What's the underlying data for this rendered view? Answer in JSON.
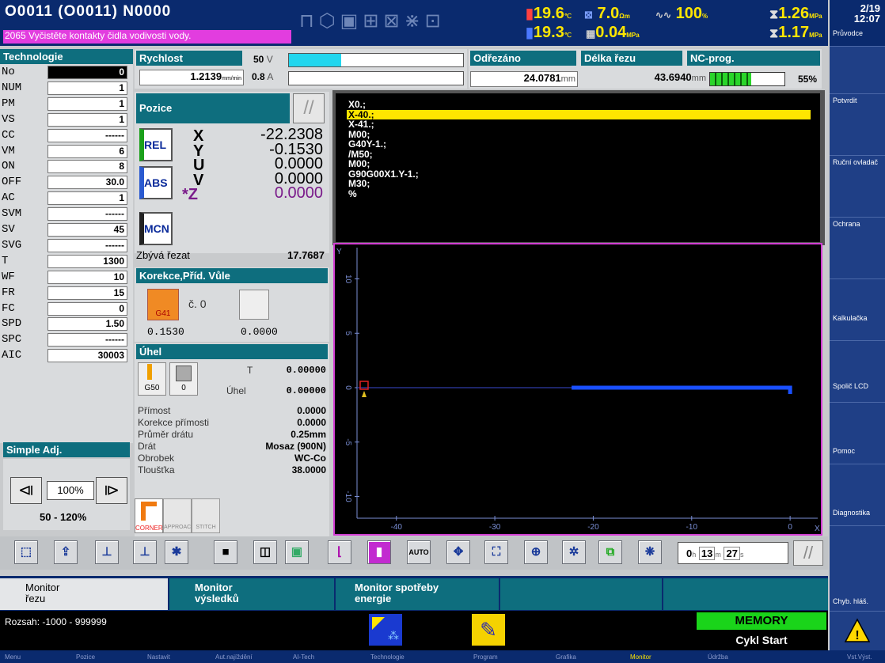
{
  "header": {
    "program_line": "O0011   (O0011)   N0000",
    "alarm_text": "2065 Vyčistěte kontakty čidla vodivosti vody.",
    "readouts": [
      {
        "value": "19.6",
        "unit": "℃"
      },
      {
        "value": "7.0",
        "unit": "Ωm"
      },
      {
        "value": "100",
        "unit": "%"
      },
      {
        "value": "1.26",
        "unit": "MPa"
      },
      {
        "value": "19.3",
        "unit": "℃"
      },
      {
        "value": "0.04",
        "unit": "MPa"
      },
      {
        "value": "1.17",
        "unit": "MPa"
      }
    ]
  },
  "clock": {
    "date": "2/19",
    "time": "12:07",
    "label": "Průvodce"
  },
  "softkeys": [
    "Potvrdit",
    "Ruční ovladač",
    "Ochrana",
    "Kalkulačka",
    "Spolič LCD",
    "Pomoc",
    "Diagnostika",
    "Chyb. hláš."
  ],
  "technologie": {
    "title": "Technologie",
    "rows": [
      {
        "label": "No",
        "value": "0"
      },
      {
        "label": "NUM",
        "value": "1"
      },
      {
        "label": "PM",
        "value": "1"
      },
      {
        "label": "VS",
        "value": "1"
      },
      {
        "label": "CC",
        "value": "------"
      },
      {
        "label": "VM",
        "value": "6"
      },
      {
        "label": "ON",
        "value": "8"
      },
      {
        "label": "OFF",
        "value": "30.0"
      },
      {
        "label": "AC",
        "value": "1"
      },
      {
        "label": "SVM",
        "value": "------"
      },
      {
        "label": "SV",
        "value": "45"
      },
      {
        "label": "SVG",
        "value": "------"
      },
      {
        "label": "T",
        "value": "1300"
      },
      {
        "label": "WF",
        "value": "10"
      },
      {
        "label": "FR",
        "value": "15"
      },
      {
        "label": "FC",
        "value": "0"
      },
      {
        "label": "SPD",
        "value": "1.50"
      },
      {
        "label": "SPC",
        "value": "------"
      },
      {
        "label": "AIC",
        "value": "30003"
      }
    ]
  },
  "simple_adj": {
    "title": "Simple Adj.",
    "value": "100%",
    "range": "50 - 120%"
  },
  "rychlost": {
    "title": "Rychlost",
    "speed": "1.2139",
    "speed_unit": "mm/min",
    "voltage": "50",
    "voltage_unit": "V",
    "current": "0.8",
    "current_unit": "A",
    "voltage_fill": 0.3,
    "current_fill": 0.0
  },
  "odrezano": {
    "title": "Odřezáno",
    "value": "24.0781",
    "unit": "mm"
  },
  "delka": {
    "title": "Délka řezu",
    "value": "43.6940",
    "unit": "mm"
  },
  "ncprog": {
    "title": "NC-prog.",
    "percent": "55%",
    "fill": 0.55
  },
  "pozice": {
    "title": "Pozice",
    "modes": [
      "REL",
      "ABS",
      "MCN"
    ],
    "axes": [
      {
        "name": "X",
        "value": "-22.2308"
      },
      {
        "name": "Y",
        "value": "-0.1530"
      },
      {
        "name": "U",
        "value": "0.0000"
      },
      {
        "name": "V",
        "value": "0.0000"
      },
      {
        "name": "*Z",
        "value": "0.0000"
      }
    ]
  },
  "zbyva": {
    "label": "Zbývá řezat",
    "value": "17.7687"
  },
  "korekce": {
    "title": "Korekce,Příd. Vůle",
    "code": "G41",
    "cislo_label": "č.",
    "cislo": "0",
    "left_value": "0.1530",
    "right_value": "0.0000"
  },
  "uhel": {
    "title": "Úhel",
    "g_code": "G50",
    "g_value": "0",
    "t_label": "T",
    "t_value": "0.00000",
    "uhel_label": "Úhel",
    "uhel_value": "0.00000"
  },
  "params": [
    {
      "label": "Přímost",
      "value": "0.0000"
    },
    {
      "label": "Korekce přímosti",
      "value": "0.0000"
    },
    {
      "label": "Průměr drátu",
      "value": "0.25mm"
    },
    {
      "label": "Drát",
      "value": "Mosaz (900N)"
    },
    {
      "label": "Obrobek",
      "value": "WC-Co"
    },
    {
      "label": "Tloušťka",
      "value": "38.0000"
    }
  ],
  "corner_buttons": [
    "CORNER",
    "APPROACH",
    "STITCH"
  ],
  "nc_program": {
    "lines": [
      "X0.;",
      "X-40.;",
      "X-41.;",
      "M00;",
      "G40Y-1.;",
      "/M50;",
      "M00;",
      "G90G00X1.Y-1.;",
      "M30;",
      "%"
    ],
    "highlight_index": 1
  },
  "graph": {
    "y_ticks": [
      "10",
      "5",
      "0",
      "-5",
      "-10"
    ],
    "x_ticks": [
      "-40",
      "-30",
      "-20",
      "-10",
      "0"
    ],
    "y_axis_label": "Y",
    "x_axis_label": "X",
    "path_x": [
      -22.2,
      0
    ],
    "path_y": [
      0,
      0
    ]
  },
  "timer": {
    "hours": "0",
    "h_unit": "h",
    "minutes": "13",
    "m_unit": "m",
    "seconds": "27",
    "s_unit": "s"
  },
  "tabs": [
    {
      "label": "Monitor\nřezu"
    },
    {
      "label": "Monitor\nvýsledků"
    },
    {
      "label": "Monitor spotřeby\nenergie"
    },
    {
      "label": ""
    },
    {
      "label": ""
    }
  ],
  "status": {
    "range": "Rozsah: -1000 - 999999",
    "mode": "MEMORY",
    "cycle": "Cykl Start"
  },
  "bottom_menu": [
    "Menu",
    "Pozice",
    "Nastavit",
    "Aut.najíždění",
    "AI-Tech",
    "Technologie",
    "Program",
    "Grafika",
    "Monitor",
    "Údržba",
    "Vst.Výst."
  ]
}
